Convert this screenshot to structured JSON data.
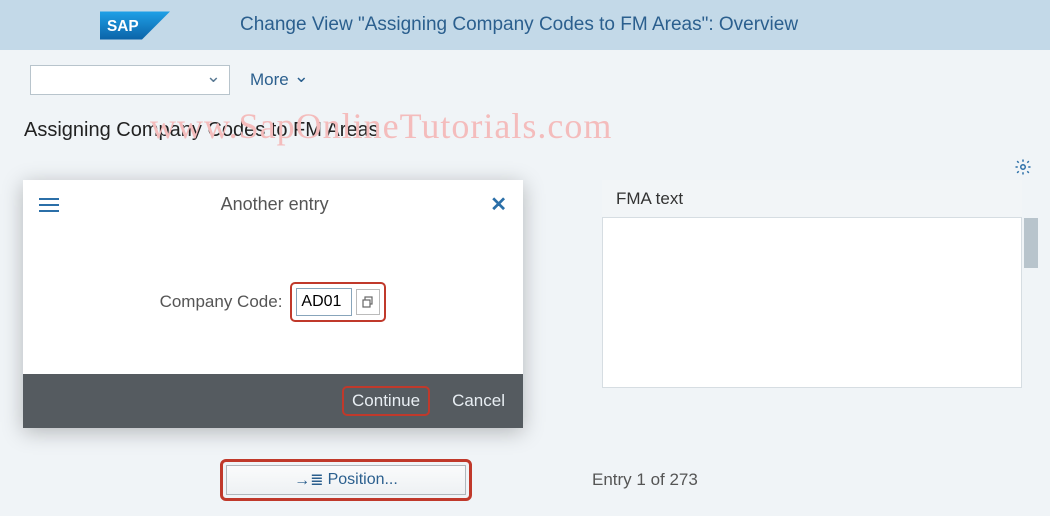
{
  "header": {
    "logo_text": "SAP",
    "title": "Change View \"Assigning Company Codes to FM Areas\": Overview"
  },
  "toolbar": {
    "more_label": "More"
  },
  "watermark": "www.SapOnlineTutorials.com",
  "section": {
    "title": "Assigning Company Codes to FM Areas"
  },
  "table": {
    "columns": {
      "fma_text": "FMA text"
    }
  },
  "dialog": {
    "title": "Another entry",
    "field_label": "Company Code:",
    "field_value": "AD01",
    "continue_label": "Continue",
    "cancel_label": "Cancel"
  },
  "footer": {
    "position_label": "Position...",
    "entry_text": "Entry 1 of 273"
  },
  "icons": {
    "position_arrow": "→≣"
  }
}
